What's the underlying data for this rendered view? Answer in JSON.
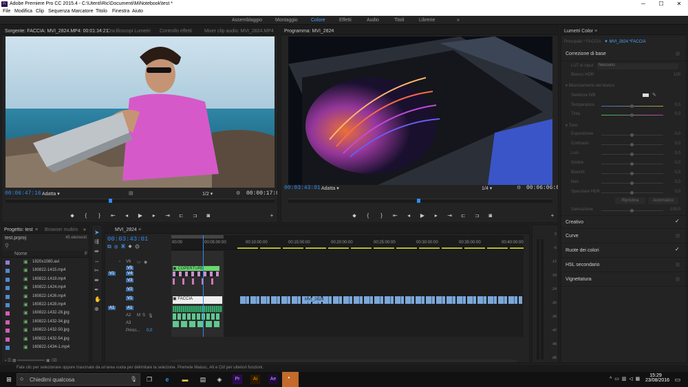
{
  "title_bar": {
    "title": "Adobe Premiere Pro CC 2015.4 - C:\\Utenti\\Ric\\Documenti\\MiNotebook\\test *",
    "logo": "Pr",
    "minimize": "─",
    "maximize": "☐",
    "close": "✕"
  },
  "menu": [
    "File",
    "Modifica",
    "Clip",
    "Sequenza",
    "Marcatore",
    "Titolo",
    "Finestra",
    "Aiuto"
  ],
  "workspaces": {
    "items": [
      "Assemblaggio",
      "Montaggio",
      "Colore",
      "Effetti",
      "Audio",
      "Titoli",
      "Librerie"
    ],
    "active": "Colore",
    "more": "»"
  },
  "source_panel": {
    "tabs": [
      "Sorgente: FACCIA: MVI_2824.MP4: 00:01:14:21",
      "Oscilloscopi Lumetri",
      "Controllo effetti",
      "Mixer clip audio: MVI_2824.MP4"
    ],
    "timecode": "00:06:47:16",
    "fit": "Adatta",
    "resolution": "1/2",
    "duration": "00:00:17:09",
    "panel_menu": "≡"
  },
  "program_panel": {
    "tab": "Programma: MVI_2824",
    "timecode": "00:03:43:01",
    "fit": "Adatta",
    "resolution": "1/4",
    "duration": "00:06:06:02",
    "panel_menu": "≡"
  },
  "project_panel": {
    "tabs": [
      "Progetto: test",
      "Browser multim"
    ],
    "panel_menu": "≡",
    "more": "»",
    "file": "test.prproj",
    "count": "45 elementi",
    "column": "Nome",
    "items": [
      {
        "name": "1920x1080.avi",
        "color": "#8d7dd8"
      },
      {
        "name": "160822-1415.mp4",
        "color": "#4f8bd0"
      },
      {
        "name": "160822-1419.mp4",
        "color": "#4f8bd0"
      },
      {
        "name": "160822-1424.mp4",
        "color": "#4f8bd0"
      },
      {
        "name": "160822-1426.mp4",
        "color": "#4f8bd0"
      },
      {
        "name": "160822-1428.mp4",
        "color": "#4f8bd0"
      },
      {
        "name": "160822-1432-28.jpg",
        "color": "#d45cb5"
      },
      {
        "name": "160822-1432-34.jpg",
        "color": "#d45cb5"
      },
      {
        "name": "160822-1432-50.jpg",
        "color": "#d45cb5"
      },
      {
        "name": "160822-1432-54.jpg",
        "color": "#d45cb5"
      },
      {
        "name": "160822-1434-1.mp4",
        "color": "#4f8bd0"
      }
    ]
  },
  "timeline": {
    "tab": "MVI_2824",
    "panel_menu": "≡",
    "timecode": "00:03:43:01",
    "ruler": [
      "00:00",
      "00:05:00:00",
      "00:10:00:00",
      "00:15:00:00",
      "00:20:00:00",
      "00:25:00:00",
      "00:30:00:00",
      "00:35:00:00",
      "00:40:00:00"
    ],
    "video_tracks": [
      "V6",
      "V5",
      "V4",
      "V3",
      "V2",
      "V1"
    ],
    "audio_tracks": [
      "A1",
      "A2",
      "A3"
    ],
    "source_patch_v": "V1",
    "source_patch_a": "A1",
    "master": "Princi...",
    "master_val": "0,0",
    "clips": {
      "coperture": "COPERTURE",
      "faccia": "FACCIA",
      "mvi": "MVI_2824"
    }
  },
  "audio_meter": {
    "labels": [
      "0",
      "-6",
      "-12",
      "-18",
      "-24",
      "-30",
      "-36",
      "-42",
      "-48",
      "dB"
    ]
  },
  "lumetri": {
    "title": "Lumetri Color",
    "panel_menu": "≡",
    "clip": "MVI_2824 *FACCIA",
    "clip_master": "Principale * FACCIA",
    "sections": [
      "Correzione di base",
      "Creativo",
      "Curve",
      "Ruote dei colori",
      "HSL secondario",
      "Vignettatura"
    ],
    "checked": [
      false,
      true,
      false,
      true,
      false,
      false
    ],
    "lut_label": "LUT di input",
    "lut_value": "Nessuno",
    "hdr_label": "Bianco HDR",
    "hdr_value": "100",
    "wb_title": "Bilanciamento del bianco",
    "wb_selector": "Selettore WB",
    "wb_sliders": [
      {
        "label": "Temperatura",
        "value": "0,0"
      },
      {
        "label": "Tinta",
        "value": "0,0"
      }
    ],
    "tone_title": "Tono",
    "tone_sliders": [
      {
        "label": "Esposizione",
        "value": "0,0"
      },
      {
        "label": "Contrasto",
        "value": "0,0"
      },
      {
        "label": "Luci",
        "value": "0,0"
      },
      {
        "label": "Ombre",
        "value": "0,0"
      },
      {
        "label": "Bianchi",
        "value": "0,0"
      },
      {
        "label": "Neri",
        "value": "0,0"
      },
      {
        "label": "Speculare HDR",
        "value": "0,0"
      }
    ],
    "reset": "Ripristina",
    "auto": "Automatico",
    "saturation": "Saturazione",
    "saturation_value": "100,0"
  },
  "status": "Fate clic per selezionare oppure trascinate da un'area vuota per delimitare la selezione. Premete Maiusc, Alt e Ctrl per ulteriori funzioni.",
  "taskbar": {
    "search": "Chiedimi qualcosa",
    "time": "15:29",
    "date": "23/08/2016",
    "app_pr": "Pr",
    "app_ai": "Ai",
    "app_ae": "Ae"
  }
}
